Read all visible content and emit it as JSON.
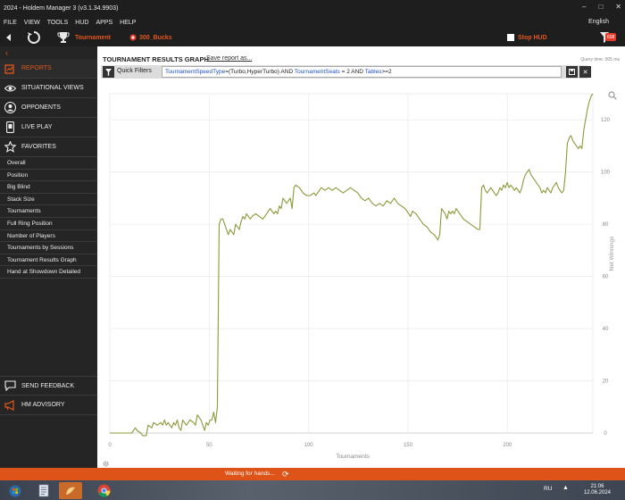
{
  "window": {
    "title": "2024 - Holdem Manager 3 (v3.1.34.9903)"
  },
  "menu": {
    "items": [
      "FILE",
      "VIEW",
      "TOOLS",
      "HUD",
      "APPS",
      "HELP"
    ],
    "language": "English"
  },
  "toolbar": {
    "tournament_label": "Tournament",
    "site_label": "300_Bucks",
    "stop_hud_label": "Stop HUD",
    "filter_badge": "608"
  },
  "sidebar": {
    "main_items": [
      {
        "label": "REPORTS",
        "icon": "reports-icon"
      },
      {
        "label": "SITUATIONAL VIEWS",
        "icon": "eye-icon"
      },
      {
        "label": "OPPONENTS",
        "icon": "user-icon"
      },
      {
        "label": "LIVE PLAY",
        "icon": "phone-icon"
      },
      {
        "label": "FAVORITES",
        "icon": "star-icon"
      }
    ],
    "sub_items": [
      "Overall",
      "Position",
      "Big Blind",
      "Stack Size",
      "Tournaments",
      "Full Ring Position",
      "Number of Players",
      "Tournaments by Sessions",
      "Tournament Results Graph",
      "Hand at Showdown Detailed"
    ],
    "bottom_items": [
      {
        "label": "SEND FEEDBACK",
        "icon": "chat-icon"
      },
      {
        "label": "HM ADVISORY",
        "icon": "megaphone-icon"
      }
    ]
  },
  "report": {
    "title": "TOURNAMENT RESULTS GRAPH",
    "save_link": "Save report as...",
    "query_time": "Query time: 005 ms",
    "quick_filters_label": "Quick Filters",
    "filter": {
      "k1": "TournamentSpeedType",
      "v1": "=(Turbo,HyperTurbo) AND ",
      "k2": "TournamentSeats",
      "v2": " = 2 AND ",
      "k3": "Tables",
      "v3": ">=2"
    }
  },
  "chart_data": {
    "type": "line",
    "xlabel": "Tournaments",
    "ylabel": "Net Winnings",
    "xlim": [
      0,
      243
    ],
    "ylim": [
      0,
      130
    ],
    "x_ticks": [
      0,
      50,
      100,
      150,
      200
    ],
    "y_ticks": [
      0,
      20,
      40,
      60,
      80,
      100,
      120
    ],
    "grid": true,
    "series": [
      {
        "color": "#8b9a3a",
        "points": [
          [
            0,
            0
          ],
          [
            12,
            0
          ],
          [
            14,
            2
          ],
          [
            15,
            1
          ],
          [
            17,
            0
          ],
          [
            18,
            -1
          ],
          [
            20,
            -1
          ],
          [
            21,
            3
          ],
          [
            23,
            2
          ],
          [
            24,
            4
          ],
          [
            26,
            3
          ],
          [
            28,
            4
          ],
          [
            29,
            3
          ],
          [
            30,
            5
          ],
          [
            31,
            3
          ],
          [
            32,
            4
          ],
          [
            34,
            2
          ],
          [
            35,
            4
          ],
          [
            36,
            3
          ],
          [
            37,
            5
          ],
          [
            38,
            2
          ],
          [
            39,
            1
          ],
          [
            40,
            5
          ],
          [
            42,
            3
          ],
          [
            43,
            4
          ],
          [
            44,
            5
          ],
          [
            46,
            4
          ],
          [
            47,
            3
          ],
          [
            48,
            7
          ],
          [
            49,
            6
          ],
          [
            50,
            5
          ],
          [
            51,
            3
          ],
          [
            52,
            1
          ],
          [
            53,
            4
          ],
          [
            54,
            3
          ],
          [
            55,
            5
          ],
          [
            56,
            5
          ],
          [
            57,
            8
          ],
          [
            58,
            4
          ],
          [
            59,
            10
          ],
          [
            60,
            80
          ],
          [
            61,
            82
          ],
          [
            62,
            82
          ],
          [
            63,
            80
          ],
          [
            64,
            78
          ],
          [
            65,
            76
          ],
          [
            66,
            78
          ],
          [
            67,
            77
          ],
          [
            68,
            76
          ],
          [
            69,
            80
          ],
          [
            70,
            79
          ],
          [
            71,
            78
          ],
          [
            72,
            81
          ],
          [
            73,
            83
          ],
          [
            74,
            82
          ],
          [
            75,
            84
          ],
          [
            76,
            83
          ],
          [
            77,
            82
          ],
          [
            78,
            83
          ],
          [
            80,
            84
          ],
          [
            82,
            83
          ],
          [
            84,
            82
          ],
          [
            86,
            84
          ],
          [
            88,
            86
          ],
          [
            89,
            85
          ],
          [
            90,
            84
          ],
          [
            91,
            85
          ],
          [
            92,
            84
          ],
          [
            93,
            87
          ],
          [
            94,
            86
          ],
          [
            95,
            90
          ],
          [
            96,
            89
          ],
          [
            97,
            88
          ],
          [
            98,
            89
          ],
          [
            99,
            90
          ],
          [
            100,
            86
          ],
          [
            101,
            94
          ],
          [
            102,
            95
          ],
          [
            104,
            94
          ],
          [
            106,
            92
          ],
          [
            108,
            91
          ],
          [
            110,
            91
          ],
          [
            112,
            92
          ],
          [
            113,
            91
          ],
          [
            114,
            92
          ],
          [
            116,
            94
          ],
          [
            118,
            93
          ],
          [
            120,
            94
          ],
          [
            122,
            93
          ],
          [
            124,
            94
          ],
          [
            126,
            93
          ],
          [
            128,
            92
          ],
          [
            130,
            93
          ],
          [
            132,
            94
          ],
          [
            134,
            93
          ],
          [
            136,
            92
          ],
          [
            138,
            90
          ],
          [
            140,
            89
          ],
          [
            142,
            90
          ],
          [
            144,
            88
          ],
          [
            146,
            87
          ],
          [
            148,
            88
          ],
          [
            150,
            87
          ],
          [
            152,
            89
          ],
          [
            154,
            88
          ],
          [
            156,
            90
          ],
          [
            158,
            88
          ],
          [
            160,
            87
          ],
          [
            162,
            86
          ],
          [
            164,
            84
          ],
          [
            165,
            83
          ],
          [
            166,
            85
          ],
          [
            168,
            84
          ],
          [
            170,
            82
          ],
          [
            172,
            80
          ],
          [
            174,
            79
          ],
          [
            176,
            77
          ],
          [
            178,
            76
          ],
          [
            180,
            74
          ],
          [
            181,
            76
          ],
          [
            182,
            86
          ],
          [
            183,
            85
          ],
          [
            184,
            84
          ],
          [
            185,
            82
          ],
          [
            186,
            85
          ],
          [
            187,
            84
          ],
          [
            188,
            85
          ],
          [
            189,
            84
          ],
          [
            190,
            86
          ],
          [
            191,
            85
          ],
          [
            192,
            84
          ],
          [
            193,
            83
          ],
          [
            194,
            82
          ],
          [
            196,
            81
          ],
          [
            198,
            80
          ],
          [
            200,
            79
          ],
          [
            202,
            78
          ],
          [
            203,
            78
          ],
          [
            204,
            94
          ],
          [
            205,
            95
          ],
          [
            206,
            93
          ],
          [
            207,
            92
          ],
          [
            208,
            93
          ],
          [
            209,
            94
          ],
          [
            210,
            93
          ],
          [
            211,
            92
          ],
          [
            212,
            91
          ],
          [
            213,
            92
          ],
          [
            214,
            94
          ],
          [
            215,
            93
          ],
          [
            216,
            95
          ],
          [
            217,
            94
          ],
          [
            218,
            96
          ],
          [
            219,
            94
          ],
          [
            220,
            95
          ],
          [
            221,
            94
          ],
          [
            222,
            93
          ],
          [
            223,
            94
          ],
          [
            224,
            93
          ],
          [
            225,
            92
          ],
          [
            226,
            94
          ],
          [
            227,
            97
          ],
          [
            228,
            99
          ],
          [
            229,
            100
          ],
          [
            230,
            101
          ],
          [
            231,
            99
          ],
          [
            232,
            98
          ],
          [
            233,
            97
          ],
          [
            234,
            96
          ],
          [
            235,
            95
          ],
          [
            236,
            94
          ],
          [
            237,
            92
          ],
          [
            238,
            93
          ],
          [
            239,
            92
          ],
          [
            240,
            94
          ],
          [
            241,
            93
          ],
          [
            242,
            92
          ],
          [
            243,
            94
          ],
          [
            244,
            95
          ],
          [
            245,
            96
          ],
          [
            246,
            94
          ],
          [
            247,
            93
          ],
          [
            248,
            92
          ],
          [
            249,
            93
          ],
          [
            250,
            100
          ],
          [
            251,
            111
          ],
          [
            252,
            113
          ],
          [
            253,
            114
          ],
          [
            254,
            112
          ],
          [
            255,
            111
          ],
          [
            256,
            110
          ],
          [
            257,
            109
          ],
          [
            258,
            110
          ],
          [
            259,
            109
          ],
          [
            260,
            116
          ],
          [
            261,
            120
          ],
          [
            262,
            124
          ],
          [
            263,
            127
          ],
          [
            264,
            129
          ],
          [
            265,
            130
          ]
        ]
      }
    ]
  },
  "status": {
    "text": "Waiting for hands..."
  },
  "taskbar": {
    "lang": "RU",
    "time": "21:06",
    "date": "12.06.2024"
  }
}
